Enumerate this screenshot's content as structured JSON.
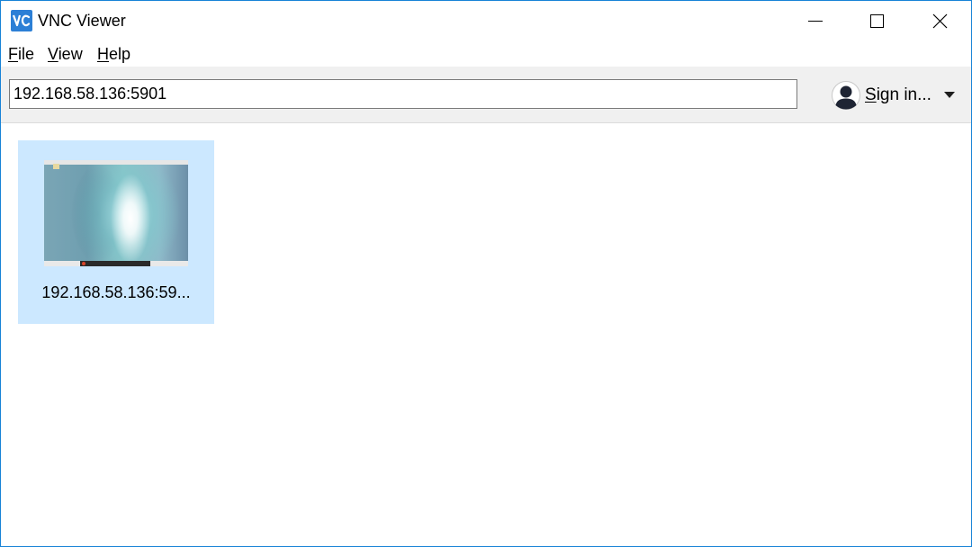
{
  "window": {
    "title": "VNC Viewer",
    "logo": "vnc-logo-icon",
    "accent_color": "#1883d7"
  },
  "menu": {
    "items": [
      {
        "mnemonic": "F",
        "rest": "ile"
      },
      {
        "mnemonic": "V",
        "rest": "iew"
      },
      {
        "mnemonic": "H",
        "rest": "elp"
      }
    ]
  },
  "toolbar": {
    "address_value": "192.168.58.136:5901",
    "signin_mnemonic": "S",
    "signin_rest": "ign in...",
    "avatar_icon": "user-avatar-icon",
    "dropdown_icon": "caret-down-icon"
  },
  "connections": [
    {
      "label": "192.168.58.136:59...",
      "selected": true,
      "selected_color": "#cce8ff"
    }
  ]
}
